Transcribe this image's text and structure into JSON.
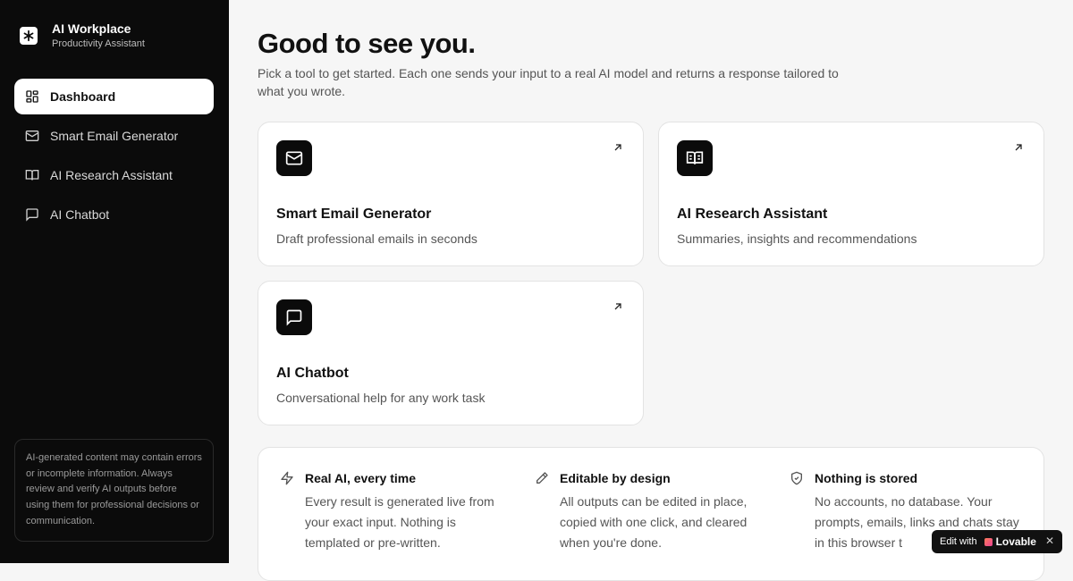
{
  "brand": {
    "title": "AI Workplace",
    "subtitle": "Productivity Assistant",
    "logo_icon": "asterisk-icon"
  },
  "sidebar": {
    "items": [
      {
        "label": "Dashboard",
        "icon": "dashboard-grid-icon",
        "active": true
      },
      {
        "label": "Smart Email Generator",
        "icon": "mail-icon",
        "active": false
      },
      {
        "label": "AI Research Assistant",
        "icon": "book-open-icon",
        "active": false
      },
      {
        "label": "AI Chatbot",
        "icon": "message-square-icon",
        "active": false
      }
    ],
    "disclaimer": "AI-generated content may contain errors or incomplete information. Always review and verify AI outputs before using them for professional decisions or communication."
  },
  "main": {
    "headline": "Good to see you.",
    "intro": "Pick a tool to get started. Each one sends your input to a real AI model and returns a response tailored to what you wrote.",
    "cards": [
      {
        "title": "Smart Email Generator",
        "description": "Draft professional emails in seconds",
        "icon": "mail-icon"
      },
      {
        "title": "AI Research Assistant",
        "description": "Summaries, insights and recommendations",
        "icon": "book-open-icon"
      },
      {
        "title": "AI Chatbot",
        "description": "Conversational help for any work task",
        "icon": "message-square-icon"
      }
    ],
    "features": [
      {
        "title": "Real AI, every time",
        "text": "Every result is generated live from your exact input. Nothing is templated or pre-written.",
        "icon": "zap-icon"
      },
      {
        "title": "Editable by design",
        "text": "All outputs can be edited in place, copied with one click, and cleared when you're done.",
        "icon": "pencil-icon"
      },
      {
        "title": "Nothing is stored",
        "text": "No accounts, no database. Your prompts, emails, links and chats stay in this browser t",
        "icon": "shield-check-icon"
      }
    ]
  },
  "badge": {
    "prefix": "Edit with",
    "brand": "Lovable",
    "close": "✕"
  },
  "colors": {
    "sidebar_bg": "#0b0b0b",
    "page_bg": "#f6f6f6",
    "card_bg": "#ffffff",
    "accent": "#111111"
  }
}
